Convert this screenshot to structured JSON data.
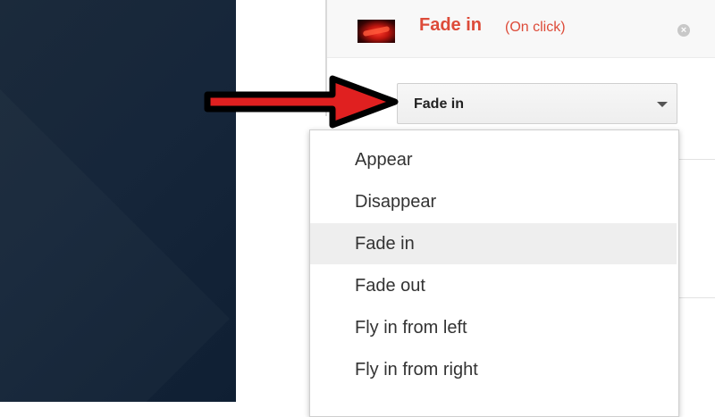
{
  "animation": {
    "title": "Fade in",
    "trigger": "(On click)",
    "close_icon": "close-icon"
  },
  "select": {
    "value": "Fade in",
    "caret_icon": "chevron-down-icon"
  },
  "dropdown": {
    "options": [
      "Appear",
      "Disappear",
      "Fade in",
      "Fade out",
      "Fly in from left",
      "Fly in from right"
    ],
    "highlighted": "Fade in"
  },
  "annotation": {
    "arrow_color": "#e02020",
    "arrow_outline": "#000000"
  },
  "colors": {
    "accent": "#dd4b39",
    "slide_background": "#16263a"
  }
}
